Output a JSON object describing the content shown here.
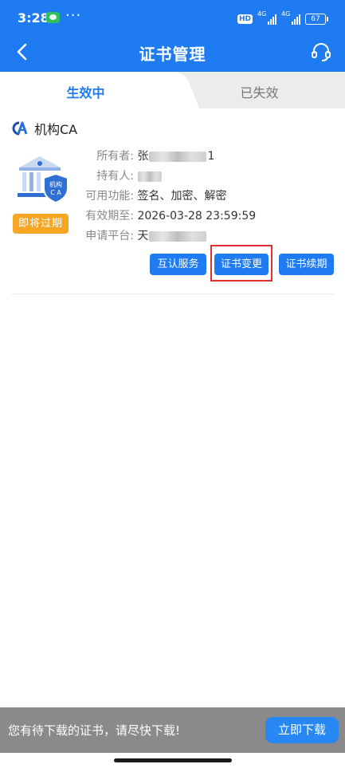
{
  "status_bar": {
    "time": "3:28",
    "more": "···",
    "hd": "HD",
    "signal1": "4G",
    "signal2": "4G",
    "battery": "67"
  },
  "header": {
    "title": "证书管理",
    "back_icon": "chevron-left-icon",
    "service_icon": "headset-icon"
  },
  "tabs": {
    "active": "生效中",
    "inactive": "已失效"
  },
  "section": {
    "title": "机构CA",
    "logo_icon": "ca-logo-icon"
  },
  "certificate": {
    "illustration_label": "机构\nC A",
    "badge": "即将过期",
    "rows": [
      {
        "label": "所有者:",
        "value_prefix": "张",
        "value_suffix": "1"
      },
      {
        "label": "持有人:",
        "value_prefix": "",
        "value_suffix": ""
      },
      {
        "label": "可用功能:",
        "value_prefix": "签名、加密、解密",
        "value_suffix": ""
      },
      {
        "label": "有效期至:",
        "value_prefix": "2026-03-28 23:59:59",
        "value_suffix": ""
      },
      {
        "label": "申请平台:",
        "value_prefix": "天",
        "value_suffix": ""
      }
    ],
    "buttons": {
      "mutual": "互认服务",
      "change": "证书变更",
      "renew": "证书续期"
    }
  },
  "bottom": {
    "notice": "您有待下载的证书，请尽快下载!",
    "download": "立即下载"
  },
  "colors": {
    "primary": "#1e7bf2",
    "badge": "#f6a623",
    "highlight": "#e03131",
    "bottom_bar": "#8a8a8a"
  }
}
